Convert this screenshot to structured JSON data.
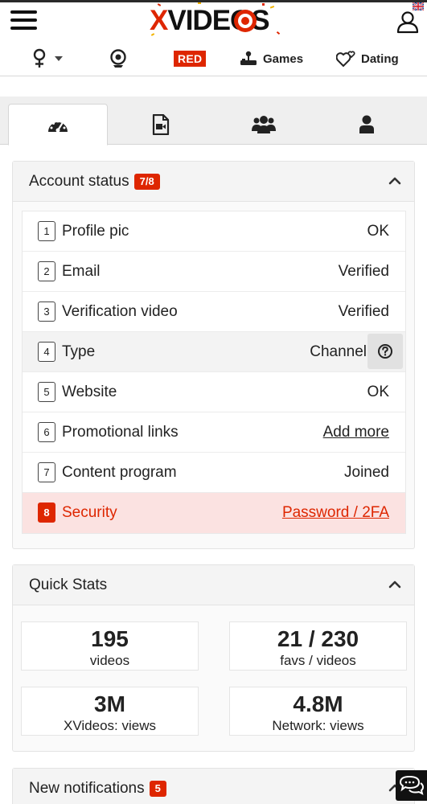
{
  "header": {
    "logo_x": "X",
    "logo_rest": "VIDEOS",
    "nav": {
      "red_label": "RED",
      "games_label": "Games",
      "dating_label": "Dating"
    }
  },
  "tabs": [
    {
      "icon": "dashboard-icon",
      "active": true
    },
    {
      "icon": "video-file-icon",
      "active": false
    },
    {
      "icon": "users-icon",
      "active": false
    },
    {
      "icon": "user-icon",
      "active": false
    }
  ],
  "account_status": {
    "title": "Account status",
    "badge": "7/8",
    "rows": [
      {
        "num": "1",
        "label": "Profile pic",
        "value": "OK"
      },
      {
        "num": "2",
        "label": "Email",
        "value": "Verified"
      },
      {
        "num": "3",
        "label": "Verification video",
        "value": "Verified"
      },
      {
        "num": "4",
        "label": "Type",
        "value": "Channel"
      },
      {
        "num": "5",
        "label": "Website",
        "value": "OK"
      },
      {
        "num": "6",
        "label": "Promotional links",
        "value": "Add more"
      },
      {
        "num": "7",
        "label": "Content program",
        "value": "Joined"
      },
      {
        "num": "8",
        "label": "Security",
        "value": "Password / 2FA"
      }
    ]
  },
  "quick_stats": {
    "title": "Quick Stats",
    "items": [
      {
        "value": "195",
        "label": "videos"
      },
      {
        "value": "21 / 230",
        "label": "favs / videos"
      },
      {
        "value": "3M",
        "label": "XVideos: views"
      },
      {
        "value": "4.8M",
        "label": "Network: views"
      }
    ]
  },
  "notifications": {
    "title": "New notifications",
    "badge": "5"
  },
  "colors": {
    "accent": "#de2600",
    "security_bg": "#fbe2e1",
    "panel_bg": "#fafafa"
  }
}
